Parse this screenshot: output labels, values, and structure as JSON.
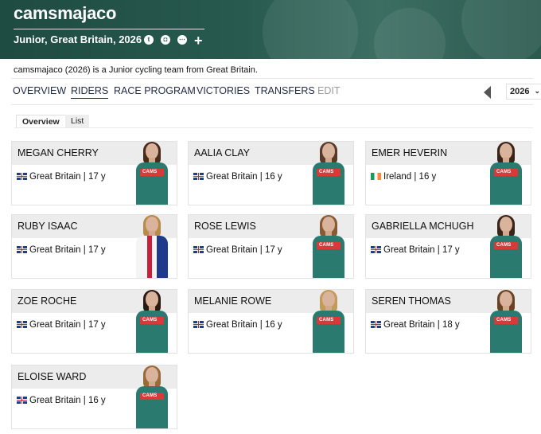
{
  "header": {
    "team_name": "camsmajaco",
    "subtitle": "Junior, Great Britain, 2026",
    "social_icons": [
      "twitter-icon",
      "instagram-icon",
      "website-icon"
    ],
    "add_icon": "plus-icon"
  },
  "description": "camsmajaco (2026) is a Junior cycling team from Great Britain.",
  "nav": {
    "items": [
      "OVERVIEW",
      "RIDERS",
      "RACE PROGRAM",
      "VICTORIES",
      "TRANSFERS",
      "EDIT"
    ],
    "active": "RIDERS",
    "year": "2026"
  },
  "subtabs": {
    "items": [
      "Overview",
      "List"
    ],
    "active": "Overview"
  },
  "riders": [
    {
      "name": "MEGAN CHERRY",
      "country": "Great Britain",
      "age": "| 17 y",
      "flag": "gb"
    },
    {
      "name": "AALIA CLAY",
      "country": "Great Britain",
      "age": "| 16 y",
      "flag": "gb"
    },
    {
      "name": "EMER HEVERIN",
      "country": "Ireland",
      "age": "| 16 y",
      "flag": "ie"
    },
    {
      "name": "RUBY ISAAC",
      "country": "Great Britain",
      "age": "| 17 y",
      "flag": "gb"
    },
    {
      "name": "ROSE LEWIS",
      "country": "Great Britain",
      "age": "| 17 y",
      "flag": "gb"
    },
    {
      "name": "GABRIELLA MCHUGH",
      "country": "Great Britain",
      "age": "| 17 y",
      "flag": "gb"
    },
    {
      "name": "ZOE ROCHE",
      "country": "Great Britain",
      "age": "| 17 y",
      "flag": "gb"
    },
    {
      "name": "MELANIE ROWE",
      "country": "Great Britain",
      "age": "| 16 y",
      "flag": "gb"
    },
    {
      "name": "SEREN THOMAS",
      "country": "Great Britain",
      "age": "| 18 y",
      "flag": "gb"
    },
    {
      "name": "ELOISE WARD",
      "country": "Great Britain",
      "age": "| 16 y",
      "flag": "gb"
    }
  ],
  "jersey_text": "CAMS",
  "colors": {
    "header_bg": "#285a50",
    "jersey_green": "#2b7a6f",
    "jersey_red": "#d83a3a",
    "nav_text": "#1f2a44"
  }
}
